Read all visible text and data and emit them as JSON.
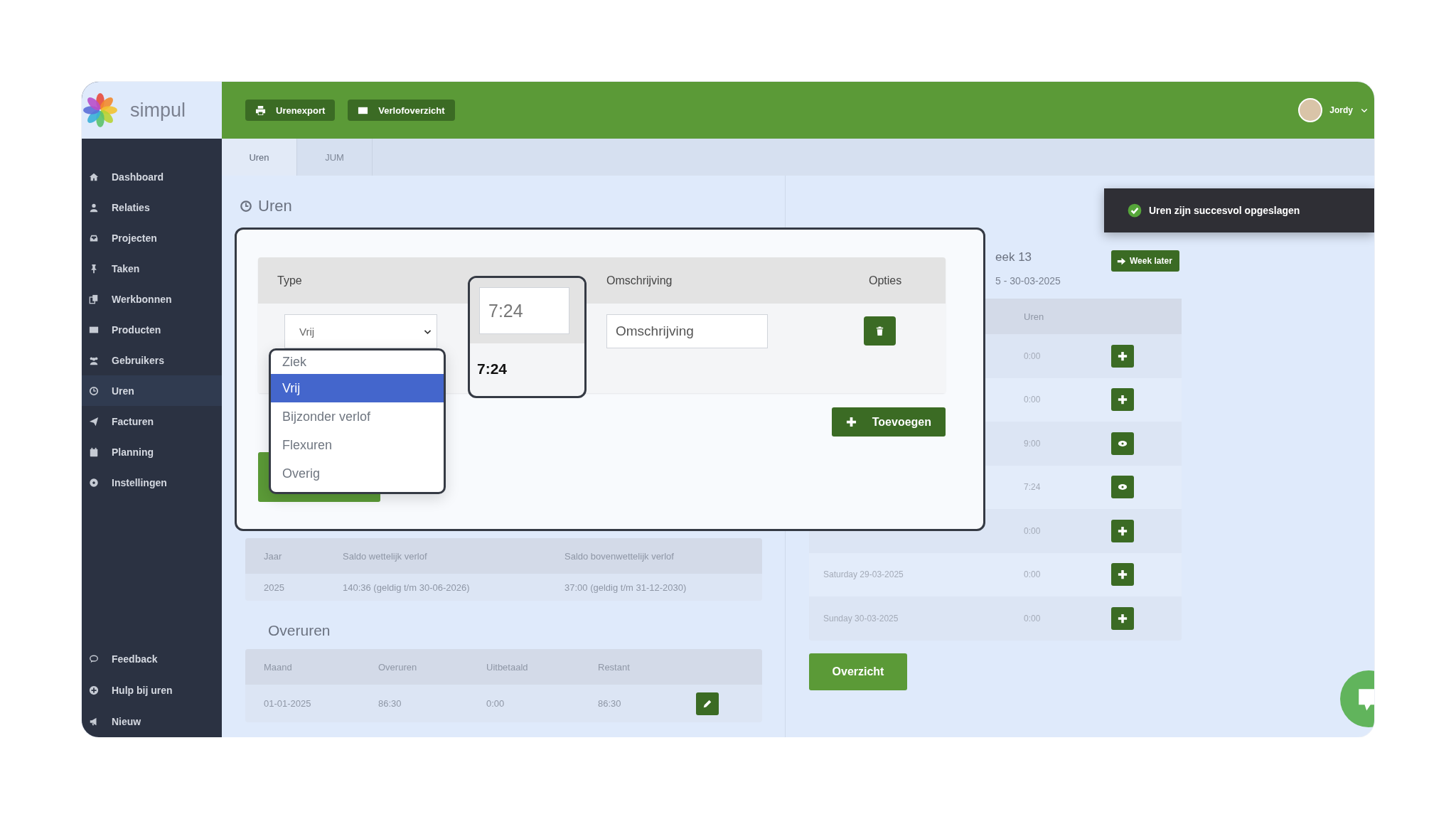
{
  "logo": "simpul",
  "topbar": {
    "buttons": [
      "Urenexport",
      "Verlofoverzicht"
    ],
    "user": "Jordy"
  },
  "sidebar": {
    "items": [
      {
        "label": "Dashboard",
        "selected": false
      },
      {
        "label": "Relaties",
        "selected": false
      },
      {
        "label": "Projecten",
        "selected": false
      },
      {
        "label": "Taken",
        "selected": false
      },
      {
        "label": "Werkbonnen",
        "selected": false
      },
      {
        "label": "Producten",
        "selected": false
      },
      {
        "label": "Gebruikers",
        "selected": false
      },
      {
        "label": "Uren",
        "selected": true
      },
      {
        "label": "Facturen",
        "selected": false
      },
      {
        "label": "Planning",
        "selected": false
      },
      {
        "label": "Instellingen",
        "selected": false
      }
    ],
    "footer": [
      "Feedback",
      "Hulp bij uren",
      "Nieuw"
    ]
  },
  "tabs": [
    {
      "label": "Uren",
      "selected": true
    },
    {
      "label": "JUM",
      "selected": false
    }
  ],
  "page_title": "Uren",
  "modal": {
    "columns": [
      "Type",
      "Omschrijving",
      "Opties"
    ],
    "type_select": {
      "value": "Vrij",
      "options": [
        {
          "label": "Ziek",
          "selected": false
        },
        {
          "label": "Vrij",
          "selected": true
        },
        {
          "label": "Bijzonder verlof",
          "selected": false
        },
        {
          "label": "Flexuren",
          "selected": false
        },
        {
          "label": "Overig",
          "selected": false
        }
      ]
    },
    "time": {
      "value": "7:24",
      "total": "7:24"
    },
    "description": {
      "placeholder": "Omschrijving"
    },
    "add_button": "Toevoegen"
  },
  "toast": {
    "text": "Uren zijn succesvol opgeslagen"
  },
  "week": {
    "title": "eek 13",
    "range": "5 - 30-03-2025",
    "next_button": "Week later",
    "column": "Uren",
    "rows": [
      {
        "hours": "0:00",
        "kind": "add"
      },
      {
        "hours": "0:00",
        "kind": "add"
      },
      {
        "hours": "9:00",
        "kind": "view"
      },
      {
        "hours": "7:24",
        "kind": "view"
      },
      {
        "hours": "0:00",
        "kind": "add"
      },
      {
        "day": "Saturday 29-03-2025",
        "hours": "0:00",
        "kind": "add"
      },
      {
        "day": "Sunday 30-03-2025",
        "hours": "0:00",
        "kind": "add"
      }
    ],
    "overview_button": "Overzicht"
  },
  "leave": {
    "columns": [
      "Jaar",
      "Saldo wettelijk verlof",
      "Saldo bovenwettelijk verlof"
    ],
    "rows": [
      [
        "2025",
        "140:36 (geldig t/m 30-06-2026)",
        "37:00 (geldig t/m 31-12-2030)"
      ]
    ]
  },
  "overtime": {
    "title": "Overuren",
    "columns": [
      "Maand",
      "Overuren",
      "Uitbetaald",
      "Restant"
    ],
    "rows": [
      [
        "01-01-2025",
        "86:30",
        "0:00",
        "86:30"
      ]
    ]
  }
}
